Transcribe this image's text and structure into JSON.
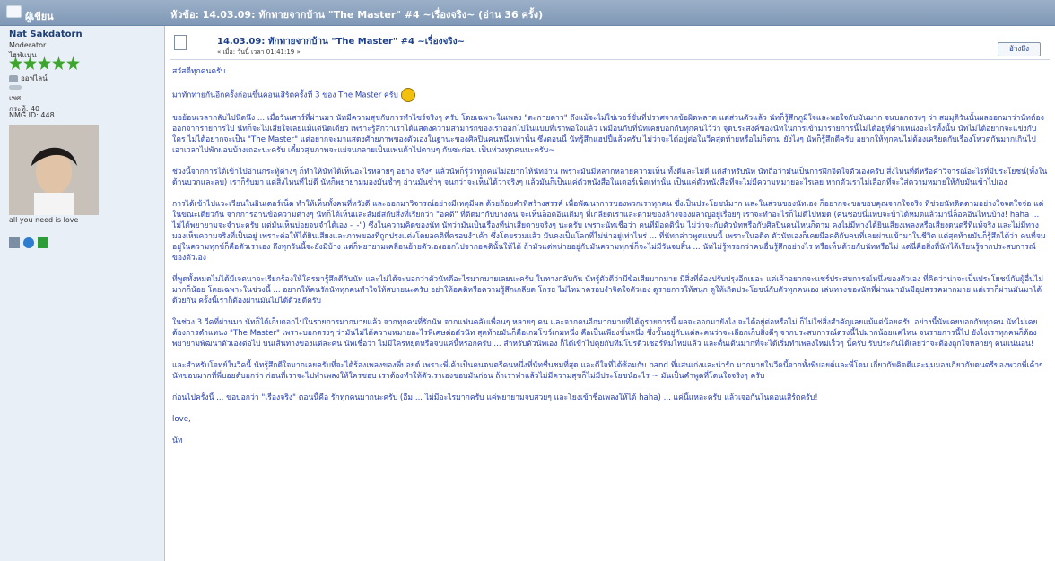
{
  "header": {
    "author_label": "ผู้เขียน",
    "topic_label": "หัวข้อ: 14.03.09: ทักทายจากบ้าน \"The Master\" #4 ~เรื่องจริง~  (อ่าน 36 ครั้ง)"
  },
  "profile": {
    "name": "Nat Sakdatorn",
    "role": "Moderator",
    "rank": "ไฮฟ่แนน",
    "status": "ออฟไลน์",
    "gender": "เพศ:",
    "posts": "กระทู้: 40",
    "nmg": "NMG ID: 448",
    "caption": "all you need is love"
  },
  "post": {
    "subject": "14.03.09: ทักทายจากบ้าน \"The Master\" #4 ~เรื่องจริง~",
    "meta": "« เมื่อ: วันนี้ เวลา 01:41:19 »",
    "quote": "อ้างถึง",
    "paragraphs": [
      "สวัสดีทุกคนครับ",
      "มาทักทายกันอีกครั้งก่อนขึ้นคอนเสิร์ตครั้งที่ 3 ของ The Master ครับ",
      "ขอย้อนเวลากลับไปนิดนึง ... เมื่อวันเสาร์ที่ผ่านมา นัทมีความสุขกับการทำไซร้จริงๆ ครับ โดยเฉพาะในเพลง \"ตะกายดาว\" ถึงแม้จะไม่ใช่เวอร์ชั่นที่ปราศจากข้อผิดพลาด แต่ส่วนตัวแล้ว นัทก็รู้สึกภูมิใจและพอใจกับมันมาก จนบอกตรงๆ ว่า สมมุติวันนั้นผลออกมาว่านัทต้องออกจากรายการไป นัทก็จะไม่เสียใจเลยแม้แต่นิดเดียว เพราะรู้สึกว่าเราได้แสดงความสามารถของเราออกไปในแบบที่เราพอใจแล้ว เหมือนกับที่นัทเคยบอกกับทุกคนไว้ว่า จุดประสงค์ของนัทในการเข้ามารายการนี้ไม่ได้อยู่ที่ตำแหน่งอะไรทั้งนั้น นัทไม่ได้อยากจะแข่งกับใคร ไม่ได้อยากจะเป็น \"The Master\" แต่อยากจะมาแสดงศักยภาพของตัวเองในฐานะของศิลปินคนหนึ่งเท่านั้น ซึ่งตอนนี้ นัทรู้สึกแฮปปี้แล้วครับ ไม่ว่าจะได้อยู่ต่อในวีคสุดท้ายหรือไม่ก็ตาม ยังไงๆ นัทก็รู้สึกดีครับ อยากให้ทุกคนไม่ต้องเครียดกับเรื่องโหวตกันมากเกินไป เอาเวลาไปพักผ่อนบ้างเถอะนะครับ เดี๋ยวสุขภาพจะแย่จนกลายเป็นแพนด้าไปตามๆ กันซะก่อน เป็นห่วงทุกคนนะครับ~",
      "ช่วงนี้จากการได้เข้าไปอ่านกระทู้ต่างๆ ก็ทำให้นัทได้เห็นอะไรหลายๆ อย่าง จริงๆ แล้วนัทก็รู้ว่าทุกคนไม่อยากให้นัทอ่าน เพราะมันมีหลากหลายความเห็น ทั้งดีและไม่ดี แต่สำหรับนัท นัทถือว่ามันเป็นการฝึกจิตใจตัวเองครับ สิ่งไหนที่ดีหรือคำวิจารณ์อะไรที่มีประโยชน์(ทั้งในด้านบวกและลบ) เราก็รับมา แต่สิ่งไหนที่ไม่ดี นัทก็พยายามมองมันซ้ำๆ อ่านมันซ้ำๆ จนกว่าจะเห็นได้ว่าจริงๆ แล้วมันก็เป็นแค่ตัวหนังสือในเดอร์เน็ตเท่านั้น เป็นแค่ตัวหนังสือที่จะไม่มีความหมายอะไรเลย หากตัวเราไม่เลือกที่จะใส่ความหมายให้กับมันเข้าไปเอง",
      "การได้เข้าไปแวะเวียนในอินเตอร์เน็ต ทำให้เห็นทั้งคนที่หวังดี และออกมาวิจารณ์อย่างมีเหตุมีผล ด้วยถ้อยคำที่สร้างสรรค์ เพื่อพัฒนาการของพวกเราทุกคน ซึ่งเป็นประโยชน์มาก และในส่วนของนัทเอง ก็อยากจะขอขอบคุณจากใจจริง ที่ช่วยนัทติดตามอย่างใจจดใจจ่อ แต่ในขณะเดียวกัน จากการอ่านข้อความต่างๆ นัทก็ได้เห็นและสัมผัสกับสิ่งที่เรียกว่า \"อคติ\" ที่ติดมากับบางคน จะเห็นล็อคอินเดิมๆ ที่เกลียดเราและตามของล้างจองผลาญอยู่เรื่อยๆ เราจะทำอะไรก็ไม่ดีไปหมด (คนชอบนี่แทบจะบ้าได้หมดแล้วมานี่ล็อคอินไหนบ้าง! haha ... ไม่ได้พยายามจะจำนะครับ แต่มันเห็นบ่อยจนจำได้เอง -_-\") ซึ่งในความคิดของนัท นัทว่ามันเป็นเรื่องที่น่าเสียดายจริงๆ นะครับ เพราะนัทเชื่อว่า คนที่มีอคตินั้น ไม่ว่าจะกับตัวนัทหรือกับศิลปินคนไหนก็ตาม คงไม่มีทางได้ยินเสียงเพลงหรือเสียงดนตรีที่แท้จริง และไม่มีทางมองเห็นความจริงที่เป็นอยู่ เพราะต่อให้ได้ยินเสียงและภาพของที่ถูกปรุงแต่งโดยอคติที่ครอบงำเค้า ซึ่งโดยรวมแล้ว มันคงเป็นโลกที่ไม่น่าอยู่เท่าไหร่ ... ที่นัทกล่าวพูดแบบนี้ เพราะในอดีต ตัวนัทเองก็เคยมีอคติกับคนที่เคยผ่านเข้ามาในชีวิต แต่สุดท้ายมันก็รู้สึกได้ว่า คนที่จมอยู่ในความทุกข์ก็คือตัวเราเอง ถึงทุกวันนี้จะยังมีบ้าง แต่ก็พยายามเคลื่อนย้ายตัวเองออกไปจากอคตินั้นให้ได้ ถ้ามัวแต่หน่ายอยู่กับมันความทุกข์ก็จะไม่มีวันจบสิ้น ... นัทไม่รู้หรอกว่าคนอื่นรู้สึกอย่างไร หรือเห็นด้วยกับนัทหรือไม่ แต่นี่คือสิ่งที่นัทได้เรียนรู้จากประสบการณ์ของตัวเอง",
      "ที่พูดทั้งหมดไม่ได้มีเจตนาจะเรียกร้องให้ใครมารู้สึกดีกับนัท และไม่ได้จะบอกว่าตัวนัทดีอะไรมากมายเลยนะครับ ในทางกลับกัน นัทรู้ตัวดีว่ามีข้อเสียมากมาย มีสิ่งที่ต้องปรับปรุงอีกเยอะ แต่เค้าอยากจะแชร์ประสบการณ์หนึ่งของตัวเอง ที่คิดว่าน่าจะเป็นประโยชน์กับผู้อื่นไม่มากก็น้อย โดยเฉพาะในช่วงนี้ ... อยากให้คนรักนัททุกคนทำใจให้สบายนะครับ อย่าให้อคติหรือความรู้สึกเกลียด โกรธ ไม่ไหมาครอบงำจิตใจตัวเอง ดูรายการให้สนุก ดูให้เกิดประโยชน์กับตัวทุกคนเอง เล่นทางของนัทที่ผ่านมามันมีอุปสรรคมากมาย แต่เราก็ผ่านมันมาได้ด้วยกัน ครั้งนี้เราก็ต้องผ่านมันไปได้ด้วยดีครับ",
      "ในช่วง 3 วีคที่ผ่านมา นัทก็ได้เก็บตอกไปในรายการมากมายแล้ว จากทุกคนที่รักนัท จากแฟนคลับเพื่อนๆ หลายๆ คน และจากคนอีกมากมายที่ได้ดูรายการนี้ ผลจะออกมายังไง จะได้อยู่ต่อหรือไม่ ก็ไม่ใช่สิ่งสำคัญเลยแม้แต่น้อยครับ อย่างนี้นัทเคยบอกกับทุกคน นัทไม่เคยต้องการตำแหน่ง \"The Master\" เพราะบอกตรงๆ ว่ามันไม่ได้ความหมายอะไรพิเศษต่อตัวนัท สุดท้ายมันก็คือเกมโชว์เกมหนึ่ง คือเป็นเพียงขั้นหนึ่ง ซึ่งขั้นอยู่กับแต่ละคนว่าจะเลือกเก็บสิ่งดีๆ จากประสบการณ์ตรงนี้ไปมากน้อยแค่ไหน จนรายการนี้ไป ยังไงเราทุกคนก็ต้องพยายามพัฒนาตัวเองต่อไป บนเส้นทางของแต่ละคน นัทเชื่อว่า ไม่มีใครหยุดหรือจบแค่นี้หรอกครับ ... สำหรับตัวนัทเอง ก็ได้เข้าไปคุยกับทีมโปรดิวเซอร์ทีมใหม่แล้ว และตื่นเต้นมากที่จะได้เริ่มทำเพลงใหม่เร็วๆ นี้ครับ รับประกันได้เลยว่าจะต้องถูกใจหลายๆ คนแน่นอน!",
      "และสำหรับโจทย์ในวีคนี้ นัทรู้สึกดีใจมากเลยครับที่จะได้ร้องเพลงของพี่บอยด์ เพราะพี่เค้าเป็นคนดนตรีคนหนึ่งที่นัทชื่นชมที่สุด และดีใจที่ได้ซ้อมกับ band ที่แสนเก่งและน่ารัก มากมายในวีคนี้จากทั้งพี่บอยด์และพี่โดม เกี่ยวกับคิดดีและมุมมองเกี่ยวกับดนตรีของพวกพี่เค้าๆ นัทขอบมากที่พี่บอยด์บอกว่า ก่อนที่เราจะไปทำเพลงให้ใครชอบ เราต้องทำให้ตัวเราเองชอบมันก่อน ถ้าเราทำแล้วไม่มีความสุขก็ไม่มีประโยชน์อะไร ~ มันเป็นคำพูดที่โดนใจจริงๆ ครับ",
      "ก่อนไปครั้งนี้ ... ขอบอกว่า \"เรื่องจริง\" ตอนนี้คือ รักทุกคนมากนะครับ (อืม ... ไม่มีอะไรมากครับ แค่พยายามจบสวยๆ และโยงเข้าชื่อเพลงให้ได้ haha) ... แค่นี้แหละครับ แล้วเจอกันในคอนเสิร์ตครับ!",
      "love,",
      "นัท"
    ]
  },
  "colors": {
    "header": "#8aa0bd",
    "link": "#233db0"
  }
}
